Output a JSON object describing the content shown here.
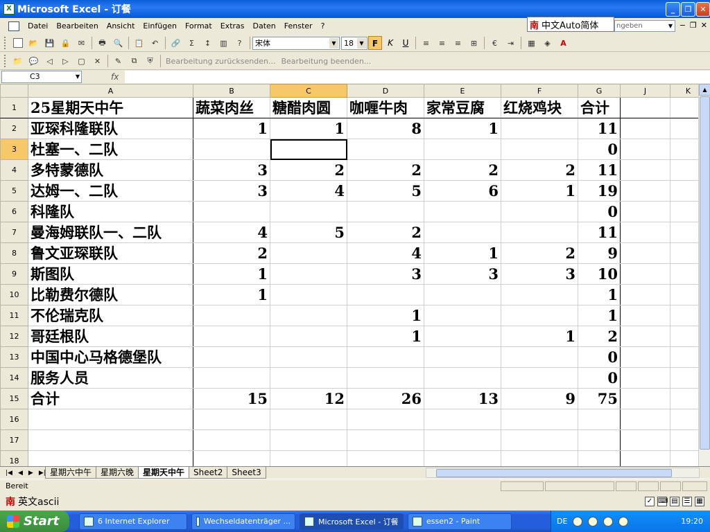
{
  "window": {
    "title": "Microsoft Excel - 订餐",
    "app_icon": "excel-icon"
  },
  "menu": [
    "Datei",
    "Bearbeiten",
    "Ansicht",
    "Einfügen",
    "Format",
    "Extras",
    "Daten",
    "Fenster",
    "?"
  ],
  "ime_popup": {
    "text": "中文Auto简体"
  },
  "help_box": {
    "placeholder": "ngeben"
  },
  "format_toolbar": {
    "font": "宋体",
    "size": "18",
    "bold": "F",
    "italic": "K",
    "underline": "U"
  },
  "review_toolbar": {
    "reply_label": "Bearbeitung zurücksenden...",
    "end_label": "Bearbeitung beenden..."
  },
  "namebox": {
    "cell": "C3"
  },
  "fx_label": "fx",
  "columns": [
    "A",
    "B",
    "C",
    "D",
    "E",
    "F",
    "G",
    "J",
    "K"
  ],
  "selected_column": "C",
  "selected_row": "3",
  "sheet": {
    "header": {
      "row": "1",
      "cells": [
        "25星期天中午",
        "蔬菜肉丝",
        "糖醋肉圆",
        "咖喱牛肉",
        "家常豆腐",
        "红烧鸡块",
        "合计",
        "",
        ""
      ]
    },
    "rows": [
      {
        "row": "2",
        "cells": [
          "亚琛科隆联队",
          "1",
          "1",
          "8",
          "1",
          "",
          "11",
          "",
          ""
        ]
      },
      {
        "row": "3",
        "cells": [
          "杜塞一、二队",
          "",
          "",
          "",
          "",
          "",
          "0",
          "",
          ""
        ]
      },
      {
        "row": "4",
        "cells": [
          "多特蒙德队",
          "3",
          "2",
          "2",
          "2",
          "2",
          "11",
          "",
          ""
        ]
      },
      {
        "row": "5",
        "cells": [
          "达姆一、二队",
          "3",
          "4",
          "5",
          "6",
          "1",
          "19",
          "",
          ""
        ]
      },
      {
        "row": "6",
        "cells": [
          "科隆队",
          "",
          "",
          "",
          "",
          "",
          "0",
          "",
          ""
        ]
      },
      {
        "row": "7",
        "cells": [
          "曼海姆联队一、二队",
          "4",
          "5",
          "2",
          "",
          "",
          "11",
          "",
          ""
        ]
      },
      {
        "row": "8",
        "cells": [
          "鲁文亚琛联队",
          "2",
          "",
          "4",
          "1",
          "2",
          "9",
          "",
          ""
        ]
      },
      {
        "row": "9",
        "cells": [
          "斯图队",
          "1",
          "",
          "3",
          "3",
          "3",
          "10",
          "",
          ""
        ]
      },
      {
        "row": "10",
        "cells": [
          "比勒费尔德队",
          "1",
          "",
          "",
          "",
          "",
          "1",
          "",
          ""
        ]
      },
      {
        "row": "11",
        "cells": [
          "不伦瑞克队",
          "",
          "",
          "1",
          "",
          "",
          "1",
          "",
          ""
        ]
      },
      {
        "row": "12",
        "cells": [
          "哥廷根队",
          "",
          "",
          "1",
          "",
          "1",
          "2",
          "",
          ""
        ]
      },
      {
        "row": "13",
        "cells": [
          "中国中心马格德堡队",
          "",
          "",
          "",
          "",
          "",
          "0",
          "",
          ""
        ]
      },
      {
        "row": "14",
        "cells": [
          "服务人员",
          "",
          "",
          "",
          "",
          "",
          "0",
          "",
          ""
        ]
      }
    ],
    "total": {
      "row": "15",
      "cells": [
        "合计",
        "15",
        "12",
        "26",
        "13",
        "9",
        "75",
        "",
        ""
      ]
    },
    "empty_rows": [
      "16",
      "17",
      "18"
    ]
  },
  "tabs": [
    {
      "label": "星期六中午",
      "active": false
    },
    {
      "label": "星期六晚",
      "active": false
    },
    {
      "label": "星期天中午",
      "active": true
    },
    {
      "label": "Sheet2",
      "active": false
    },
    {
      "label": "Sheet3",
      "active": false
    }
  ],
  "status": "Bereit",
  "ime_bar": {
    "mode": "英文ascii"
  },
  "taskbar": {
    "start": "Start",
    "tasks": [
      {
        "label": "6 Internet Explorer",
        "active": false
      },
      {
        "label": "Wechseldatenträger ...",
        "active": false
      },
      {
        "label": "Microsoft Excel - 订餐",
        "active": true
      },
      {
        "label": "essen2 - Paint",
        "active": false
      }
    ],
    "lang": "DE",
    "time": "19:20"
  }
}
